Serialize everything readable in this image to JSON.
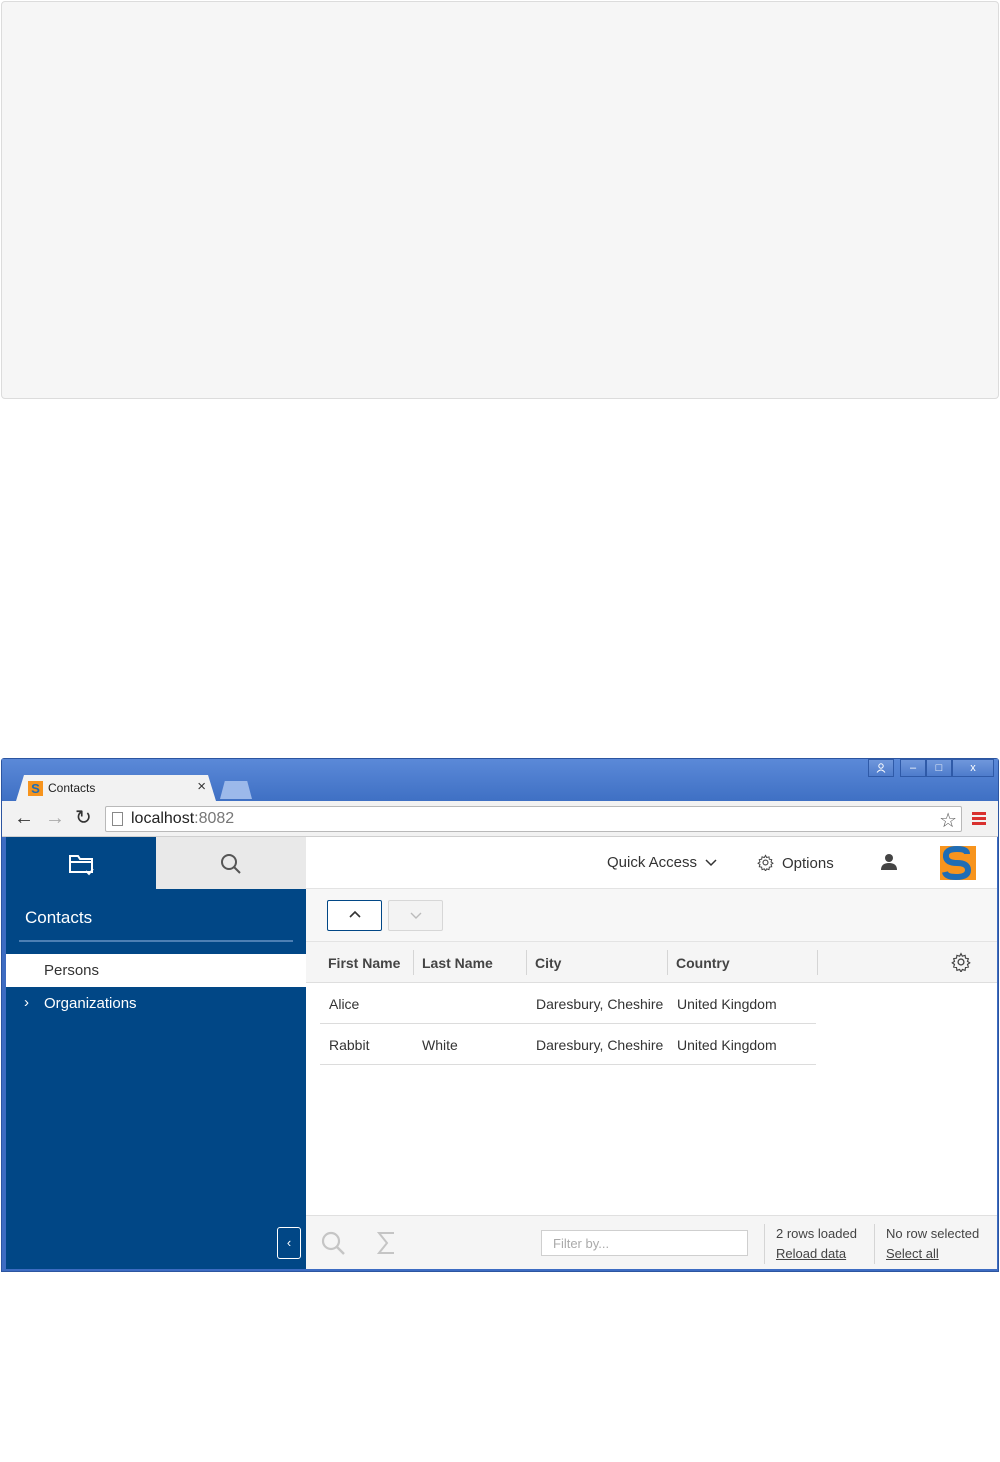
{
  "browser": {
    "tab_title": "Contacts",
    "tab_close": "×",
    "url_host": "localhost",
    "url_port": ":8082",
    "window_controls": {
      "minimize": "–",
      "maximize": "□",
      "close": "x"
    }
  },
  "sidebar": {
    "title": "Contacts",
    "items": [
      {
        "label": "Persons",
        "active": true
      },
      {
        "label": "Organizations",
        "expandable": true,
        "chevron": "›"
      }
    ],
    "collapse_icon": "‹"
  },
  "header": {
    "quick_access": "Quick Access",
    "options": "Options"
  },
  "table": {
    "columns": [
      "First Name",
      "Last Name",
      "City",
      "Country"
    ],
    "rows": [
      [
        "Alice",
        "",
        "Daresbury, Cheshire",
        "United Kingdom"
      ],
      [
        "Rabbit",
        "White",
        "Daresbury, Cheshire",
        "United Kingdom"
      ]
    ]
  },
  "footer": {
    "filter_placeholder": "Filter by...",
    "rows_loaded": "2 rows loaded",
    "reload_data": "Reload data",
    "no_row_selected": "No row selected",
    "select_all": "Select all"
  },
  "colors": {
    "sidebar_bg": "#014786",
    "logo_orange": "#f7941d",
    "logo_blue": "#1f6db5",
    "menu_red": "#d9302e"
  }
}
